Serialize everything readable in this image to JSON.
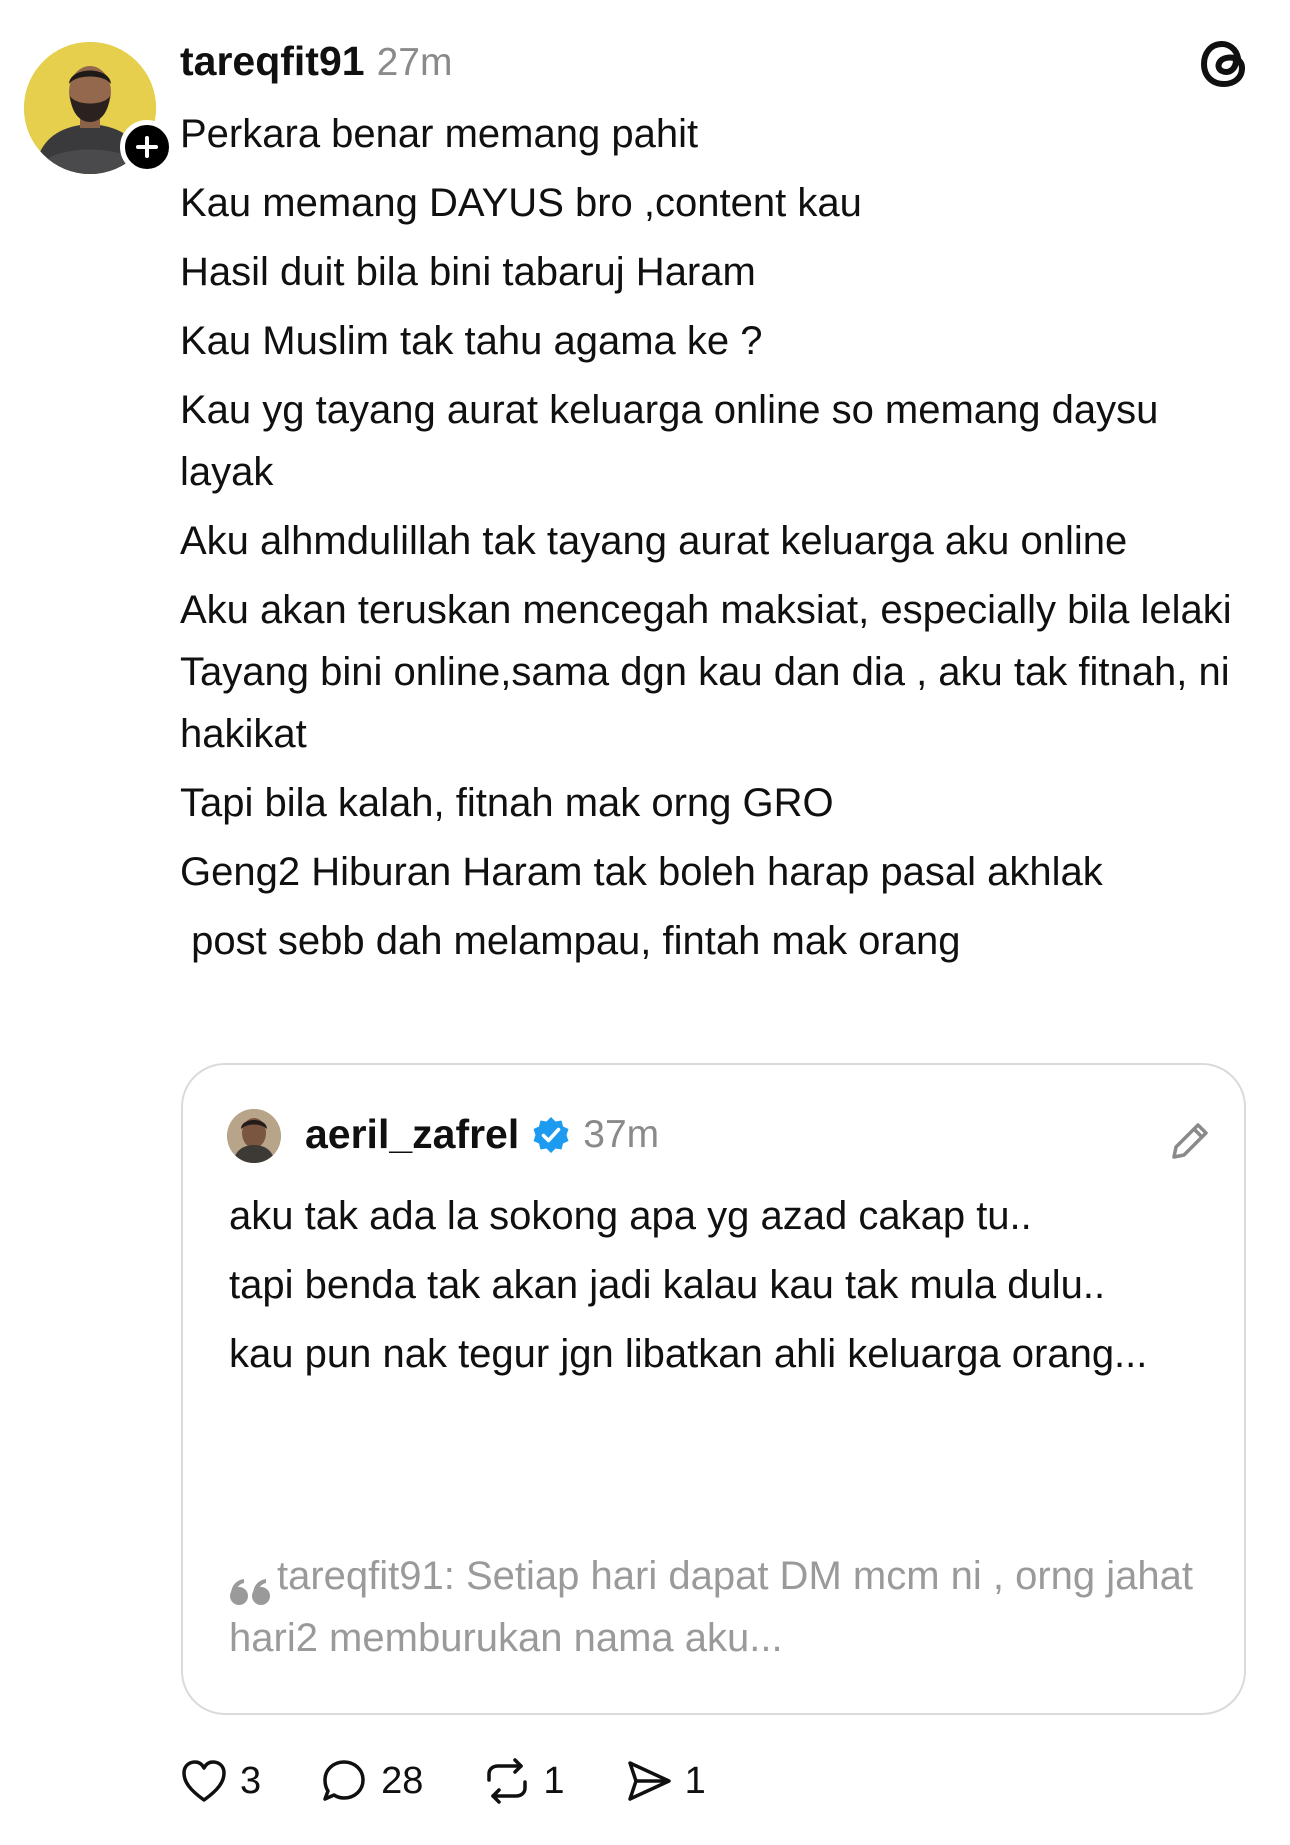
{
  "post": {
    "username": "tareqfit91",
    "time": "27m",
    "avatar_icon": "user-avatar",
    "follow_icon": "plus-icon",
    "lines": [
      "Perkara benar memang pahit",
      "Kau memang DAYUS bro ,content kau",
      "Hasil duit bila bini tabaruj Haram",
      "Kau Muslim tak tahu agama ke ?",
      "Kau yg tayang aurat keluarga online so memang daysu layak",
      "Aku alhmdulillah tak tayang aurat keluarga aku online",
      "Aku akan teruskan mencegah maksiat, especially bila lelaki Tayang bini online,sama dgn kau dan dia , aku tak fitnah, ni hakikat",
      "Tapi bila kalah, fitnah mak orng GRO",
      "Geng2 Hiburan Haram tak boleh harap pasal akhlak",
      " post sebb dah melampau, fintah mak orang"
    ]
  },
  "quoted": {
    "username": "aeril_zafrel",
    "verified_icon": "verified-badge-icon",
    "time": "37m",
    "edit_icon": "pencil-icon",
    "lines": [
      "aku tak ada la sokong apa yg azad cakap tu..",
      "tapi benda tak akan jadi kalau kau tak mula dulu..",
      "kau pun nak tegur jgn libatkan ahli keluarga orang..."
    ],
    "quote_preview": "tareqfit91: Setiap hari dapat DM mcm ni , orng jahat hari2 memburukan nama aku..."
  },
  "actions": {
    "likes": "3",
    "replies": "28",
    "reposts": "1",
    "shares": "1"
  },
  "colors": {
    "text": "#101010",
    "muted": "#8a8a8a",
    "border": "#dadada",
    "verified": "#1d9bf0",
    "avatar_bg": "#e5cf4c"
  }
}
